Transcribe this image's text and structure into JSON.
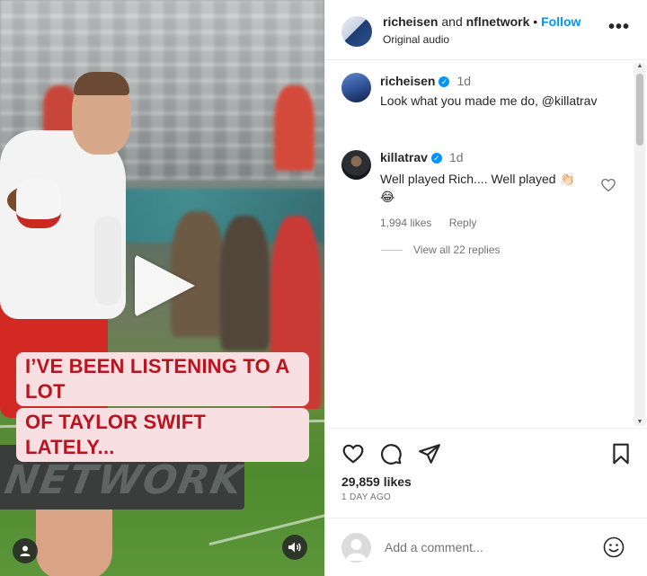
{
  "video": {
    "caption_lines": [
      "I’VE BEEN LISTENING TO A LOT",
      "OF TAYLOR SWIFT LATELY..."
    ],
    "sign_text": "NETWORK",
    "icons": {
      "play": "play-icon",
      "profile": "user-icon",
      "audio": "speaker-icon"
    }
  },
  "header": {
    "user1": "richeisen",
    "and": "and",
    "user2": "nflnetwork",
    "separator": "•",
    "follow": "Follow",
    "subtitle": "Original audio",
    "more": "•••"
  },
  "caption_comment": {
    "username": "richeisen",
    "time": "1d",
    "text": "Look what you made me do, @killatrav"
  },
  "comment": {
    "username": "killatrav",
    "time": "1d",
    "text_line1": "Well played Rich.... Well played 👏🏻",
    "text_line2": "😂",
    "likes": "1,994 likes",
    "reply": "Reply",
    "view_replies": "View all 22 replies"
  },
  "post": {
    "likes": "29,859 likes",
    "posted": "1 DAY AGO",
    "comment_placeholder": "Add a comment..."
  },
  "colors": {
    "accent": "#0095f6",
    "caption_text": "#b9141f",
    "caption_bg": "#f8dfe1"
  }
}
